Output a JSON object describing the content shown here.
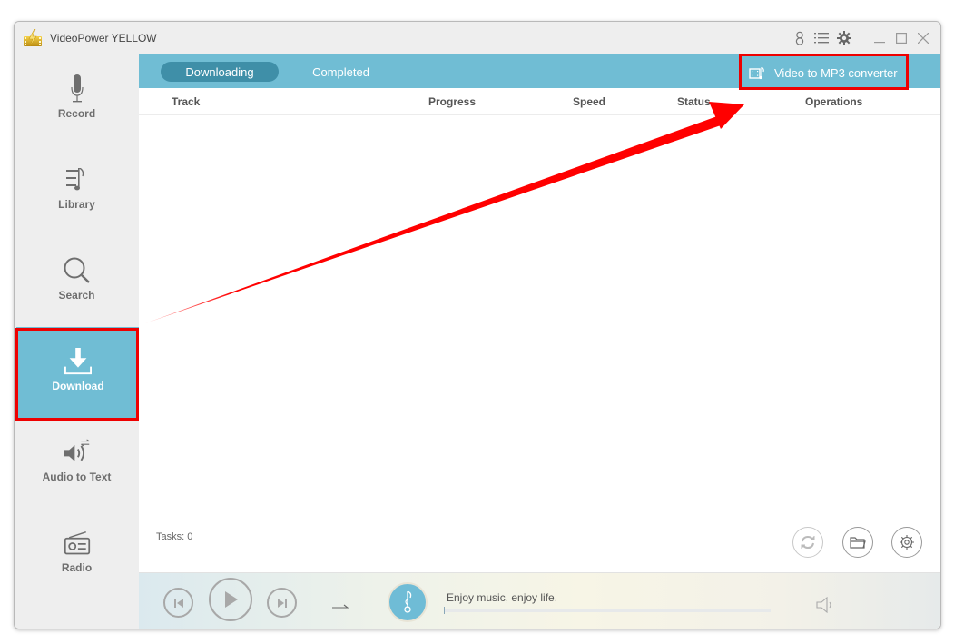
{
  "app": {
    "title": "VideoPower YELLOW",
    "accent_color": "#70bdd4",
    "highlight_color": "#ee0000"
  },
  "titlebar": {
    "icons": [
      "user-icon",
      "menu-list-icon",
      "settings-gear-icon"
    ],
    "window_controls": [
      "minimize",
      "maximize",
      "close"
    ]
  },
  "sidebar": {
    "items": [
      {
        "label": "Record",
        "icon": "microphone-icon",
        "active": false
      },
      {
        "label": "Library",
        "icon": "music-list-icon",
        "active": false
      },
      {
        "label": "Search",
        "icon": "search-icon",
        "active": false
      },
      {
        "label": "Download",
        "icon": "download-icon",
        "active": true
      },
      {
        "label": "Audio to Text",
        "icon": "speaker-convert-icon",
        "active": false
      },
      {
        "label": "Radio",
        "icon": "radio-icon",
        "active": false
      }
    ]
  },
  "tabs": [
    {
      "label": "Downloading",
      "active": true
    },
    {
      "label": "Completed",
      "active": false
    }
  ],
  "converter_button": {
    "label": "Video to MP3 converter",
    "icon": "film-music-icon"
  },
  "table": {
    "columns": [
      "Track",
      "Progress",
      "Speed",
      "Status",
      "Operations"
    ],
    "rows": []
  },
  "footer": {
    "tasks_label": "Tasks: 0",
    "action_buttons": [
      "refresh-icon",
      "folder-icon",
      "settings-icon"
    ]
  },
  "player": {
    "tagline": "Enjoy music, enjoy life.",
    "progress": 0,
    "play_mode_icon": "sequential-arrow-icon"
  }
}
